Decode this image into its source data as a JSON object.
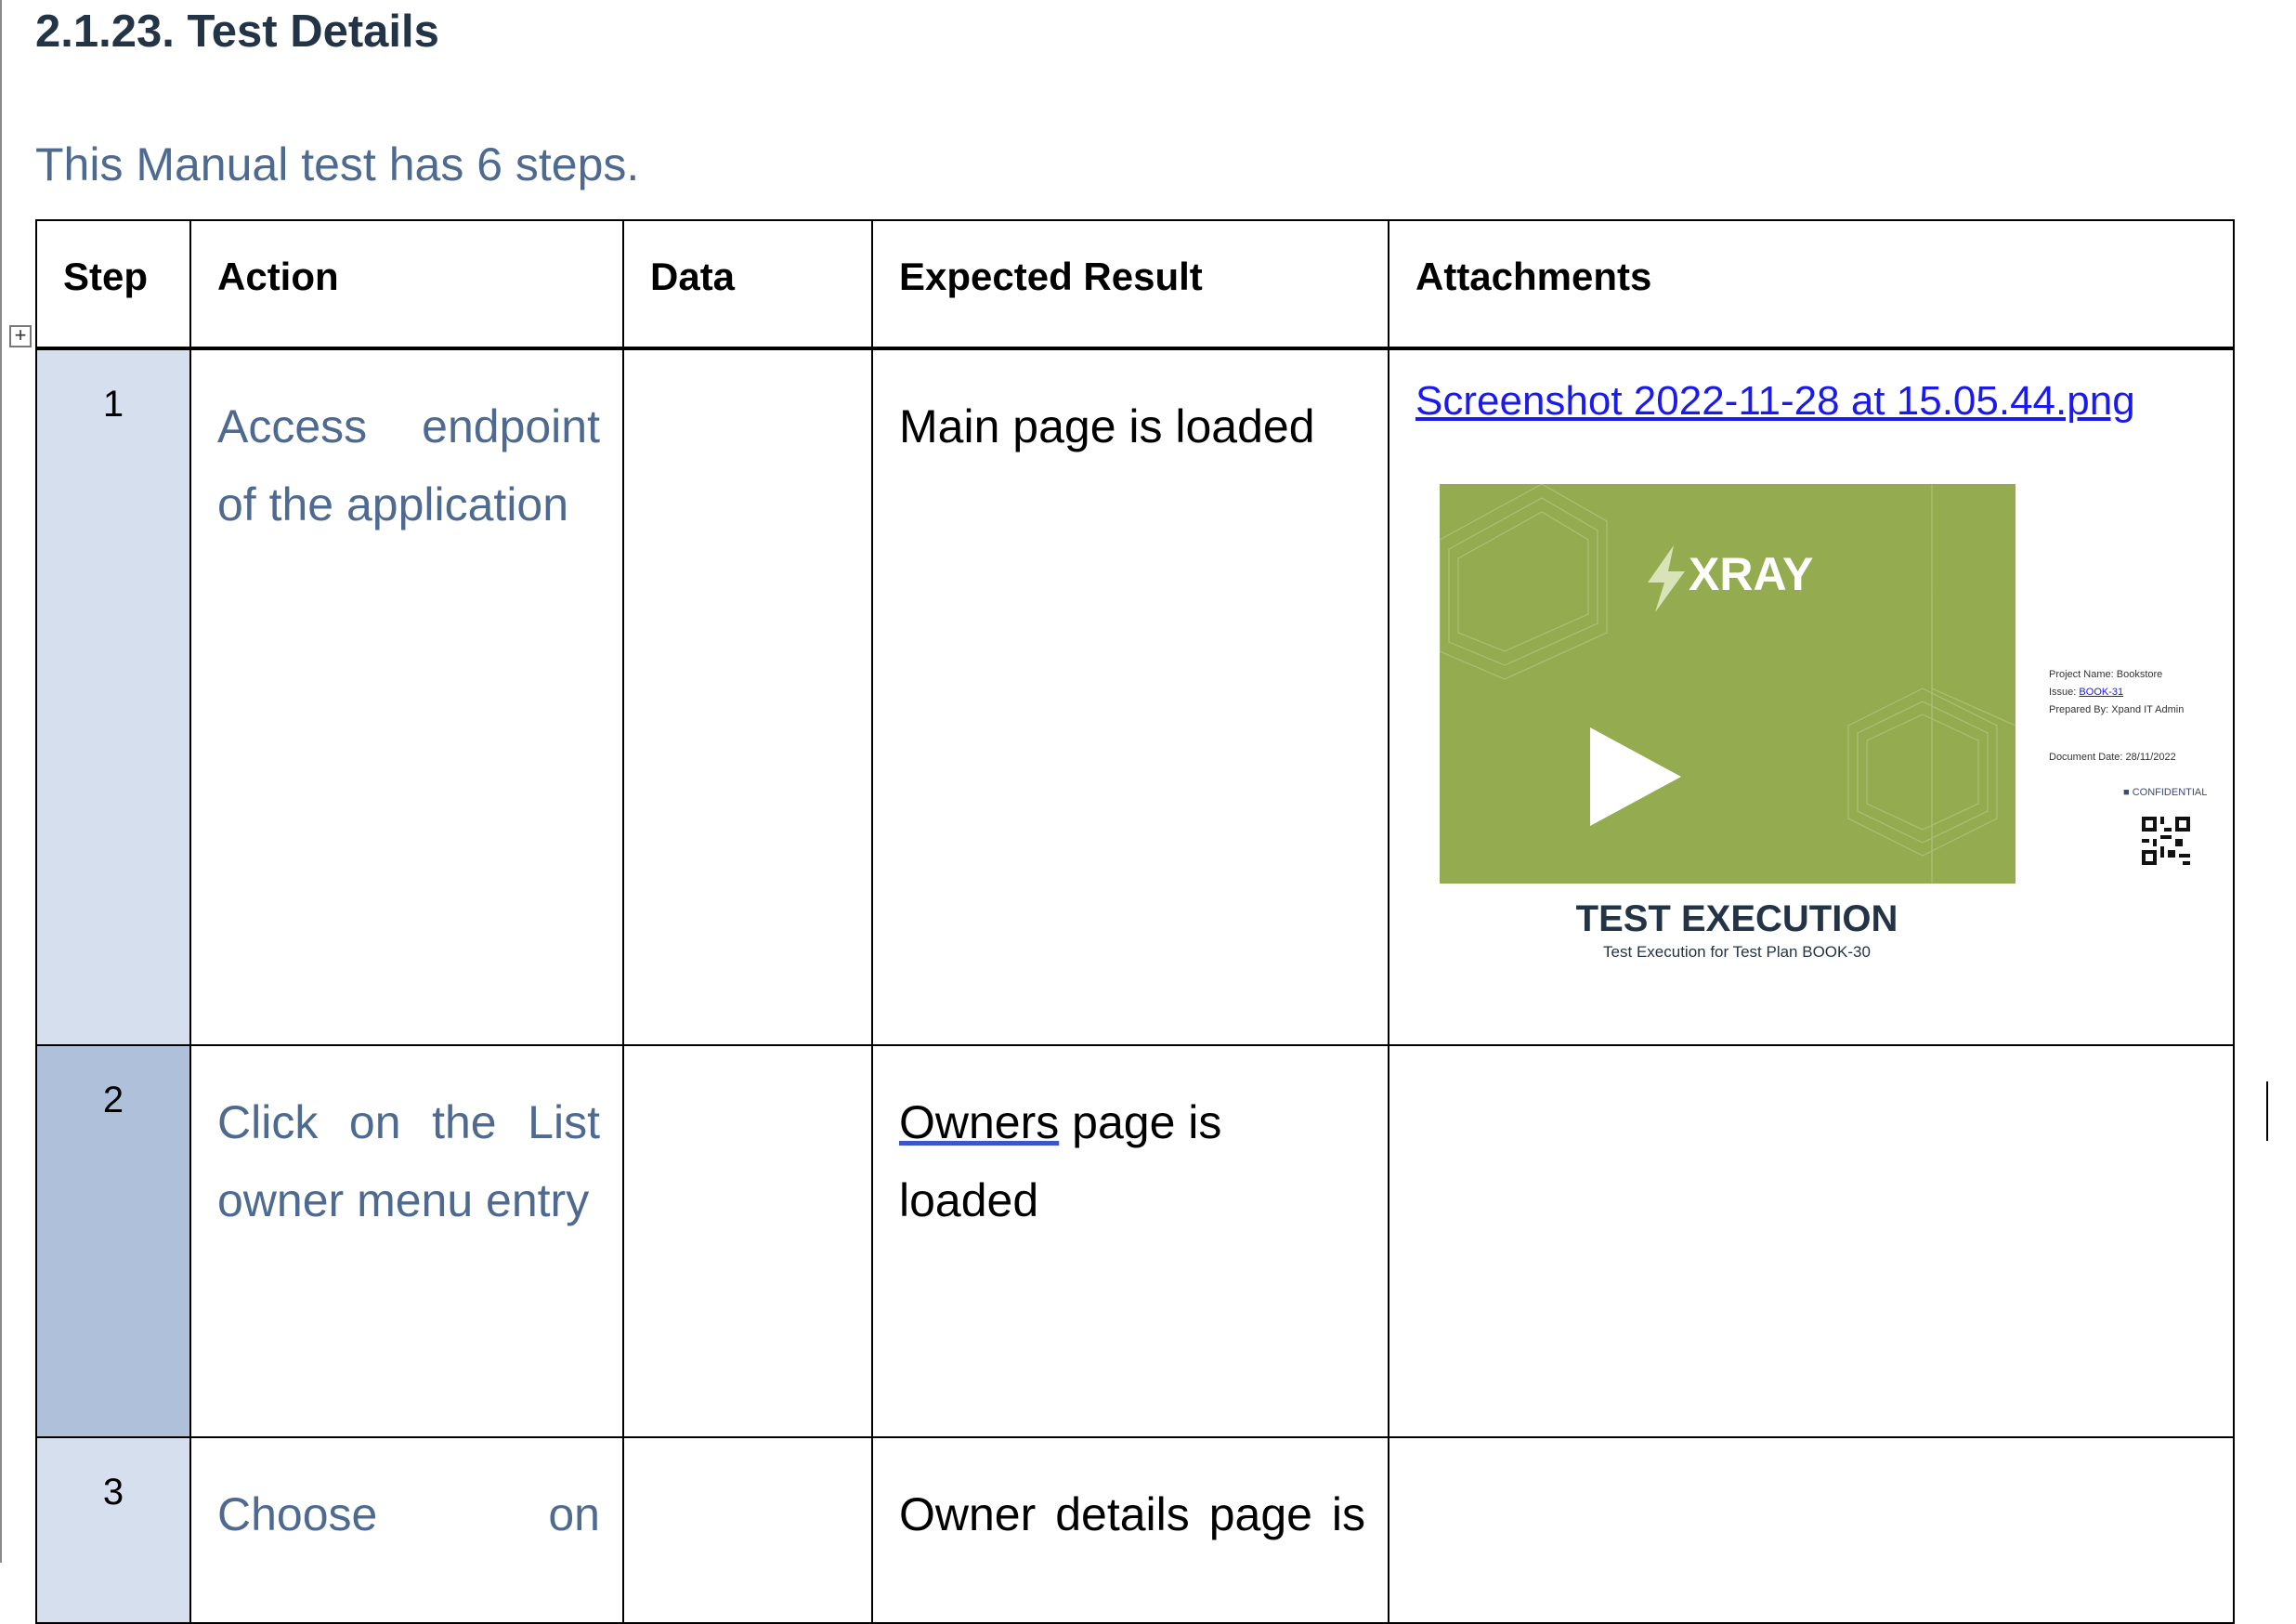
{
  "document": {
    "heading": "2.1.23. Test Details",
    "intro": "This Manual test has 6 steps."
  },
  "table": {
    "headers": [
      "Step",
      "Action",
      "Data",
      "Expected Result",
      "Attachments"
    ],
    "rows": [
      {
        "step": "1",
        "action": "Access endpoint of the application",
        "data": "",
        "expected": "Main page is loaded",
        "attachment_link": "Screenshot 2022-11-28 at 15.05.44.png"
      },
      {
        "step": "2",
        "action": "Click on the List owner menu entry",
        "data": "",
        "expected_underlined": "Owners",
        "expected_rest": " page is loaded",
        "attachment_link": ""
      },
      {
        "step": "3",
        "action": "Choose on",
        "data": "",
        "expected": "Owner details page is",
        "attachment_link": ""
      }
    ]
  },
  "thumbnail": {
    "logo": "XRAY",
    "project": "Project Name: Bookstore",
    "issue_label": "Issue:",
    "issue_link": "BOOK-31",
    "prepared": "Prepared By: Xpand IT Admin",
    "date": "Document Date: 28/11/2022",
    "confidential": "CONFIDENTIAL",
    "title": "TEST EXECUTION",
    "subtitle": "Test Execution for Test Plan BOOK-30",
    "colors": {
      "green": "#94ab50",
      "title": "#243447"
    }
  },
  "icons": [
    "table-move-handle-icon",
    "play-icon",
    "bolt-icon",
    "qr-code-icon"
  ]
}
